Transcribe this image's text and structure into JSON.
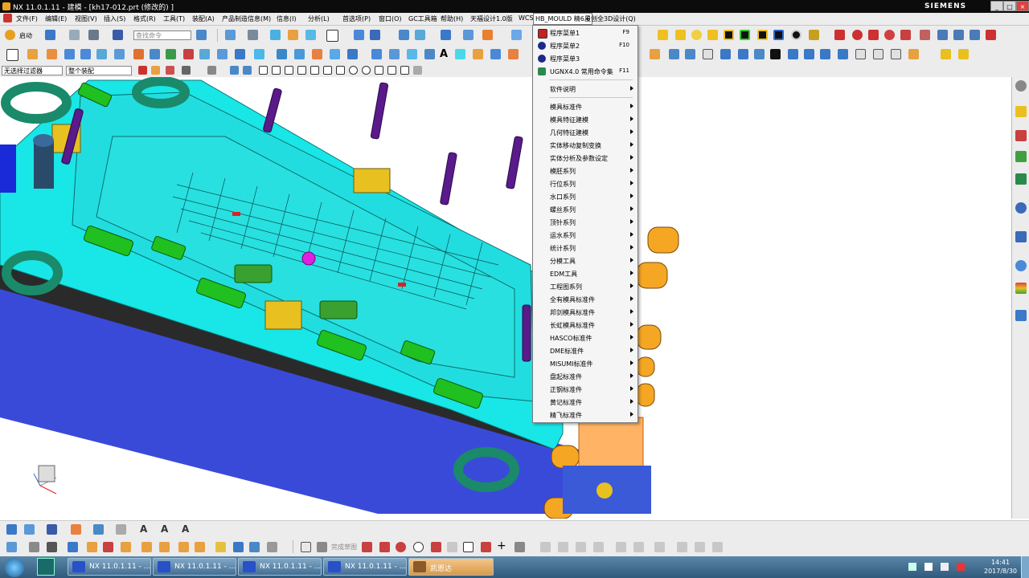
{
  "window": {
    "title": "NX 11.0.1.11 - 建模 - [kh17-012.prt (修改的) ]",
    "brand": "SIEMENS",
    "controls": [
      "_",
      "□",
      "×"
    ]
  },
  "menubar": {
    "items": [
      "文件(F)",
      "编辑(E)",
      "视图(V)",
      "插入(S)",
      "格式(R)",
      "工具(T)",
      "装配(A)",
      "产品制造信息(M)",
      "信息(I)",
      "分析(L)",
      "首选项(P)",
      "窗口(O)",
      "GC工具箱",
      "帮助(H)",
      "天福设计1.0版",
      "WCS",
      "HB_MOULD 精6.6",
      "星创全3D设计(Q)"
    ],
    "active_index": 16
  },
  "toolbar1": {
    "start_label": "启动",
    "search_placeholder": "查找命令"
  },
  "selection_bar": {
    "filter_value": "无选择过滤器",
    "scope_value": "整个装配"
  },
  "dropdown": {
    "items": [
      {
        "label": "程序菜单1",
        "shortcut": "F9",
        "submenu": false,
        "icon": "red-square-icon"
      },
      {
        "label": "程序菜单2",
        "shortcut": "F10",
        "submenu": false,
        "icon": "blue-circle-icon"
      },
      {
        "label": "程序菜单3",
        "shortcut": "",
        "submenu": false,
        "icon": "blue-circle-icon"
      },
      {
        "label": "UGNX4.0 常用命令集",
        "shortcut": "F11",
        "submenu": false,
        "icon": "ugnx-icon"
      },
      {
        "label": "软件说明",
        "shortcut": "",
        "submenu": true
      },
      {
        "label": "模具标准件",
        "shortcut": "",
        "submenu": true
      },
      {
        "label": "模具特征建模",
        "shortcut": "",
        "submenu": true
      },
      {
        "label": "几何特征建模",
        "shortcut": "",
        "submenu": true
      },
      {
        "label": "实体移动复制变换",
        "shortcut": "",
        "submenu": true
      },
      {
        "label": "实体分析及参数设定",
        "shortcut": "",
        "submenu": true
      },
      {
        "label": "模胚系列",
        "shortcut": "",
        "submenu": true
      },
      {
        "label": "行位系列",
        "shortcut": "",
        "submenu": true
      },
      {
        "label": "水口系列",
        "shortcut": "",
        "submenu": true
      },
      {
        "label": "螺丝系列",
        "shortcut": "",
        "submenu": true
      },
      {
        "label": "顶针系列",
        "shortcut": "",
        "submenu": true
      },
      {
        "label": "运水系列",
        "shortcut": "",
        "submenu": true
      },
      {
        "label": "统计系列",
        "shortcut": "",
        "submenu": true
      },
      {
        "label": "分模工具",
        "shortcut": "",
        "submenu": true
      },
      {
        "label": "EDM工具",
        "shortcut": "",
        "submenu": true
      },
      {
        "label": "工程图系列",
        "shortcut": "",
        "submenu": true
      },
      {
        "label": "全有模具标准件",
        "shortcut": "",
        "submenu": true
      },
      {
        "label": "邦剑模具标准件",
        "shortcut": "",
        "submenu": true
      },
      {
        "label": "长虹模具标准件",
        "shortcut": "",
        "submenu": true
      },
      {
        "label": "HASCO标准件",
        "shortcut": "",
        "submenu": true
      },
      {
        "label": "DME标准件",
        "shortcut": "",
        "submenu": true
      },
      {
        "label": "MISUMI标准件",
        "shortcut": "",
        "submenu": true
      },
      {
        "label": "盘起标准件",
        "shortcut": "",
        "submenu": true
      },
      {
        "label": "正钢标准件",
        "shortcut": "",
        "submenu": true
      },
      {
        "label": "黄记标准件",
        "shortcut": "",
        "submenu": true
      },
      {
        "label": "精飞标准件",
        "shortcut": "",
        "submenu": true
      }
    ]
  },
  "bottom_toolbar": {
    "sketch_label": "完成草图"
  },
  "taskbar": {
    "tasks": [
      {
        "label": "NX 11.0.1.11 - ...",
        "active": false
      },
      {
        "label": "NX 11.0.1.11 - ...",
        "active": false
      },
      {
        "label": "NX 11.0.1.11 - ...",
        "active": false
      },
      {
        "label": "NX 11.0.1.11 - ...",
        "active": false
      },
      {
        "label": "凯恩达",
        "active": true
      }
    ],
    "time": "14:41",
    "date": "2017/8/30"
  },
  "colors": {
    "mold_plate": "#19e6e6",
    "menu_highlight": "#ffffff",
    "taskbar": "#3a6a8e",
    "bolt": "#5a1a8a",
    "ring": "#1a8a6a",
    "pad": "#20c020",
    "orange_pin": "#f5a623"
  }
}
